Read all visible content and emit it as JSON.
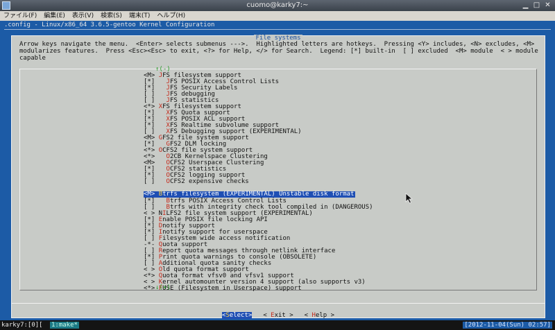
{
  "window": {
    "title": "cuomo@karky7:~",
    "controls": [
      "▁",
      "□",
      "✕"
    ]
  },
  "menubar": [
    "ファイル(F)",
    "編集(E)",
    "表示(V)",
    "検索(S)",
    "端末(T)",
    "ヘルプ(H)"
  ],
  "terminal": {
    "kconfig_title": ".config - Linux/x86_64 3.6.5-gentoo Kernel Configuration",
    "dialog_title": "File systems",
    "help_text": "Arrow keys navigate the menu.  <Enter> selects submenus --->.  Highlighted letters are hotkeys.  Pressing <Y> includes, <N> excludes, <M>\nmodularizes features.  Press <Esc><Esc> to exit, <?> for Help, </> for Search.  Legend: [*] built-in  [ ] excluded  <M> module  < > module\ncapable",
    "scroll_up": "↑(-)",
    "scroll_down": "↓(+)",
    "items": [
      {
        "prefix": "<M> ",
        "hotkey": "J",
        "rest": "FS filesystem support"
      },
      {
        "prefix": "[*]   ",
        "hotkey": "J",
        "rest": "FS POSIX Access Control Lists"
      },
      {
        "prefix": "[*]   ",
        "hotkey": "J",
        "rest": "FS Security Labels"
      },
      {
        "prefix": "[ ]   ",
        "hotkey": "J",
        "rest": "FS debugging"
      },
      {
        "prefix": "[ ]   ",
        "hotkey": "J",
        "rest": "FS statistics"
      },
      {
        "prefix": "<*> ",
        "hotkey": "X",
        "rest": "FS filesystem support"
      },
      {
        "prefix": "[*]   ",
        "hotkey": "X",
        "rest": "FS Quota support"
      },
      {
        "prefix": "[*]   ",
        "hotkey": "X",
        "rest": "FS POSIX ACL support"
      },
      {
        "prefix": "[*]   ",
        "hotkey": "X",
        "rest": "FS Realtime subvolume support"
      },
      {
        "prefix": "[ ]   ",
        "hotkey": "X",
        "rest": "FS Debugging support (EXPERIMENTAL)"
      },
      {
        "prefix": "<M> ",
        "hotkey": "G",
        "rest": "FS2 file system support"
      },
      {
        "prefix": "[*]   ",
        "hotkey": "G",
        "rest": "FS2 DLM locking"
      },
      {
        "prefix": "<*> ",
        "hotkey": "O",
        "rest": "CFS2 file system support"
      },
      {
        "prefix": "<*>   ",
        "hotkey": "O",
        "rest": "2CB Kernelspace Clustering"
      },
      {
        "prefix": "<M>   ",
        "hotkey": "O",
        "rest": "CFS2 Userspace Clustering"
      },
      {
        "prefix": "[*]   ",
        "hotkey": "O",
        "rest": "CFS2 statistics"
      },
      {
        "prefix": "[*]   ",
        "hotkey": "O",
        "rest": "CFS2 logging support"
      },
      {
        "prefix": "[ ]   ",
        "hotkey": "O",
        "rest": "CFS2 expensive checks"
      },
      {
        "prefix": "<M> ",
        "hotkey": "B",
        "rest": "trfs filesystem (EXPERIMENTAL) Unstable disk format",
        "selected": true
      },
      {
        "prefix": "[*]   ",
        "hotkey": "B",
        "rest": "trfs POSIX Access Control Lists"
      },
      {
        "prefix": "[ ]   ",
        "hotkey": "B",
        "rest": "trfs with integrity check tool compiled in (DANGEROUS)"
      },
      {
        "prefix": "< > N",
        "hotkey": "I",
        "rest": "LFS2 file system support (EXPERIMENTAL)"
      },
      {
        "prefix": "[*] ",
        "hotkey": "E",
        "rest": "nable POSIX file locking API"
      },
      {
        "prefix": "[*] ",
        "hotkey": "D",
        "rest": "notify support"
      },
      {
        "prefix": "[*] ",
        "hotkey": "I",
        "rest": "notify support for userspace"
      },
      {
        "prefix": "[ ] ",
        "hotkey": "F",
        "rest": "ilesystem wide access notification"
      },
      {
        "prefix": "-*- ",
        "hotkey": "Q",
        "rest": "uota support"
      },
      {
        "prefix": "[ ] ",
        "hotkey": "R",
        "rest": "eport quota messages through netlink interface"
      },
      {
        "prefix": "[*] ",
        "hotkey": "P",
        "rest": "rint quota warnings to console (OBSOLETE)"
      },
      {
        "prefix": "[ ] ",
        "hotkey": "A",
        "rest": "dditional quota sanity checks"
      },
      {
        "prefix": "< > ",
        "hotkey": "O",
        "rest": "ld quota format support"
      },
      {
        "prefix": "<*> ",
        "hotkey": "Q",
        "rest": "uota format vfsv0 and vfsv1 support"
      },
      {
        "prefix": "< > ",
        "hotkey": "K",
        "rest": "ernel automounter version 4 support (also supports v3)"
      },
      {
        "prefix": "<*> ",
        "hotkey": "F",
        "rest": "USE (Filesystem in Userspace) support"
      }
    ],
    "buttons": [
      {
        "pre": "<",
        "hotkey": "S",
        "post": "elect>",
        "active": true
      },
      {
        "pre": "< ",
        "hotkey": "E",
        "post": "xit >",
        "active": false
      },
      {
        "pre": "< ",
        "hotkey": "H",
        "post": "elp >",
        "active": false
      }
    ]
  },
  "statusbar": {
    "session": "karky7:[0][",
    "window_tag": "1:make*",
    "clock": "[2012-11-04(Sun) 02:57]"
  },
  "colors": {
    "terminal_bg": "#1c5ba6",
    "dialog_bg": "#c8cbc7",
    "selection": "#1f4fb4",
    "hotkey": "#c42b1c"
  }
}
